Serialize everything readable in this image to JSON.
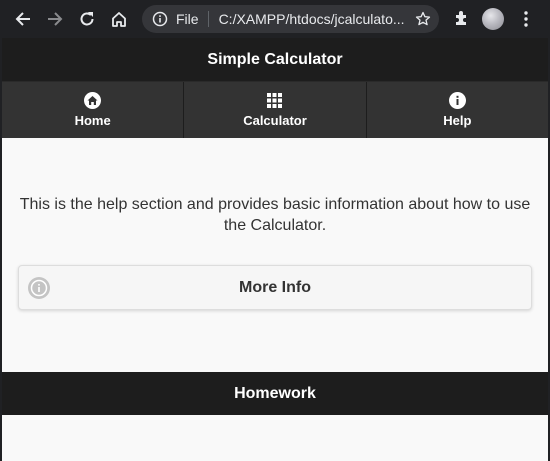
{
  "browser": {
    "scheme_label": "File",
    "url": "C:/XAMPP/htdocs/jcalculato...",
    "icons": [
      "back-icon",
      "forward-icon",
      "reload-icon",
      "home-icon",
      "info-icon",
      "star-icon",
      "extensions-icon",
      "menu-dots-icon"
    ]
  },
  "app": {
    "title": "Simple Calculator",
    "nav": [
      {
        "label": "Home",
        "icon": "home-icon"
      },
      {
        "label": "Calculator",
        "icon": "grid-icon"
      },
      {
        "label": "Help",
        "icon": "info-icon"
      }
    ],
    "help_text": "This is the help section and provides basic information about how to use the Calculator.",
    "more_info_label": "More Info",
    "footer_title": "Homework"
  },
  "colors": {
    "chrome_bg": "#202124",
    "header_bg": "#1d1d1d",
    "nav_bg": "#333333",
    "page_bg": "#f9f9f9"
  }
}
